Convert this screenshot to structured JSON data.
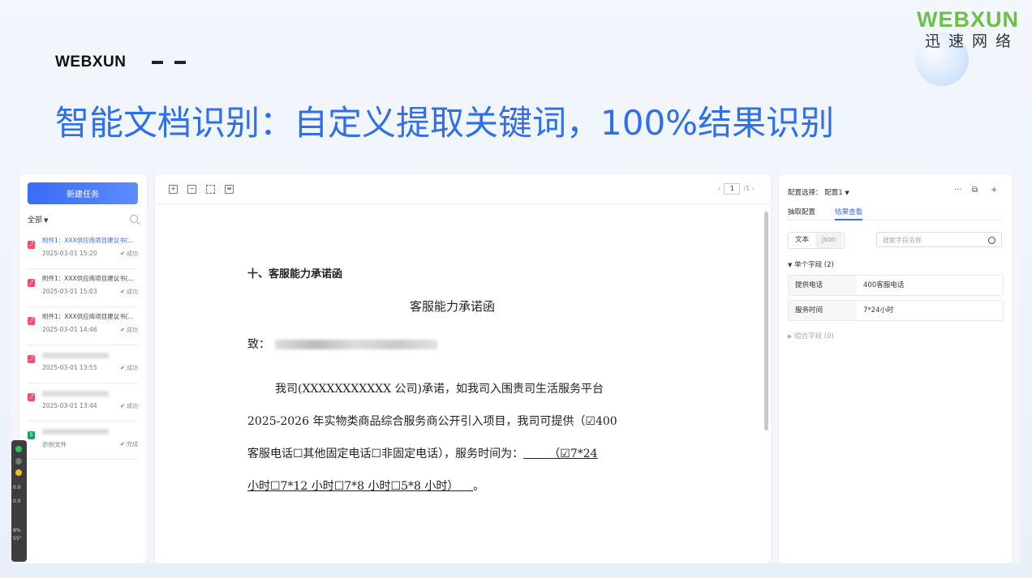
{
  "slide": {
    "brand_left": "WEBXUN",
    "logo_word": "WEBXUN",
    "logo_cn": "迅速网络",
    "headline": "智能文档识别：自定义提取关键词，100%结果识别"
  },
  "colors": {
    "accent": "#3a6cf6",
    "headline": "#2f6fea",
    "logo_green": "#6cc04a",
    "success": "#1ea35f",
    "pdf": "#f04f6b"
  },
  "left": {
    "new_task_label": "新建任务",
    "filter_label": "全部",
    "files": [
      {
        "name": "附件1：XXX供应商项目建议书(...",
        "date": "2025-03-01 15:20",
        "status": "成功",
        "active": true,
        "icon": "pdf-icon"
      },
      {
        "name": "附件1：XXX供应商项目建议书(...",
        "date": "2025-03-01 15:03",
        "status": "成功",
        "icon": "pdf-icon"
      },
      {
        "name": "附件1：XXX供应商项目建议书(...",
        "date": "2025-03-01 14:46",
        "status": "成功",
        "icon": "pdf-icon"
      },
      {
        "name": "",
        "date": "2025-03-01 13:55",
        "status": "成功",
        "icon": "pdf-icon"
      },
      {
        "name": "",
        "date": "2025-03-01 13:44",
        "status": "成功",
        "icon": "pdf-icon"
      },
      {
        "name": "",
        "date": "示例文件",
        "status": "完成",
        "icon": "sheet-icon"
      }
    ]
  },
  "viewer": {
    "page_current": "1",
    "page_total": "/1",
    "section_heading": "十、客服能力承诺函",
    "doc_title": "客服能力承诺函",
    "to_label": "致：",
    "body_1": "我司(XXXXXXXXXXX 公司)承诺，如我司入围贵司生活服务平台",
    "body_2": "2025-2026 年实物类商品综合服务商公开引入项目，我司可提供（☑400",
    "body_3a": "客服电话☐其他固定电话☐非固定电话），服务时间为：",
    "body_3b": "（☑7*24",
    "body_4": "小时☐7*12 小时☐7*8 小时☐5*8 小时）",
    "body_4_end": "。"
  },
  "right": {
    "config_label": "配置选择：",
    "config_value": "配置1",
    "tab_extract": "抽取配置",
    "tab_result": "结果查看",
    "seg_text": "文本",
    "seg_json": "json",
    "search_placeholder": "搜索字段名称",
    "single_section": "单个字段  (2)",
    "fields": [
      {
        "key": "提供电话",
        "value": "400客服电话"
      },
      {
        "key": "服务时间",
        "value": "7*24小时"
      }
    ],
    "group_section": "组合字段  (0)"
  },
  "gadget": {
    "t1": "0.0",
    "t2": "0.0",
    "t3": "8%",
    "t4": "55°"
  }
}
